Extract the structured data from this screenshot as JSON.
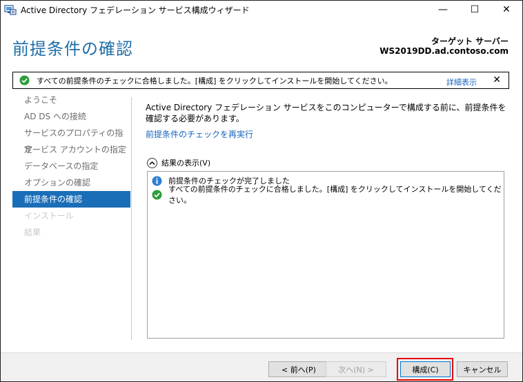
{
  "window": {
    "title": "Active Directory フェデレーション サービス構成ウィザード",
    "minimize": "—",
    "maximize": "☐",
    "close": "✕"
  },
  "header": {
    "title": "前提条件の確認",
    "target_label": "ターゲット サーバー",
    "target_server": "WS2019DD.ad.contoso.com"
  },
  "notification": {
    "text": "すべての前提条件のチェックに合格しました。[構成] をクリックしてインストールを開始してください。",
    "details_link": "詳細表示",
    "close": "✕"
  },
  "nav": {
    "items": [
      {
        "label": "ようこそ",
        "state": "normal"
      },
      {
        "label": "AD DS への接続",
        "state": "normal"
      },
      {
        "label": "サービスのプロパティの指定",
        "state": "normal"
      },
      {
        "label": "サービス アカウントの指定",
        "state": "normal"
      },
      {
        "label": "データベースの指定",
        "state": "normal"
      },
      {
        "label": "オプションの確認",
        "state": "normal"
      },
      {
        "label": "前提条件の確認",
        "state": "active"
      },
      {
        "label": "インストール",
        "state": "disabled"
      },
      {
        "label": "結果",
        "state": "disabled"
      }
    ]
  },
  "content": {
    "description": "Active Directory フェデレーション サービスをこのコンピューターで構成する前に、前提条件を確認する必要があります。",
    "rerun_link": "前提条件のチェックを再実行",
    "results_toggle": "結果の表示(V)",
    "results": [
      {
        "icon": "info-icon",
        "text": "前提条件のチェックが完了しました"
      },
      {
        "icon": "check-icon",
        "text": "すべての前提条件のチェックに合格しました。[構成] をクリックしてインストールを開始してください。"
      }
    ]
  },
  "footer": {
    "back": "< 前へ(P)",
    "next": "次へ(N) >",
    "configure": "構成(C)",
    "cancel": "キャンセル"
  },
  "colors": {
    "accent": "#1a6eb8",
    "title_blue": "#1e6ea8",
    "link": "#1565c0",
    "success": "#2e9e3a",
    "info": "#2f7fd0",
    "highlight": "#e60000"
  }
}
